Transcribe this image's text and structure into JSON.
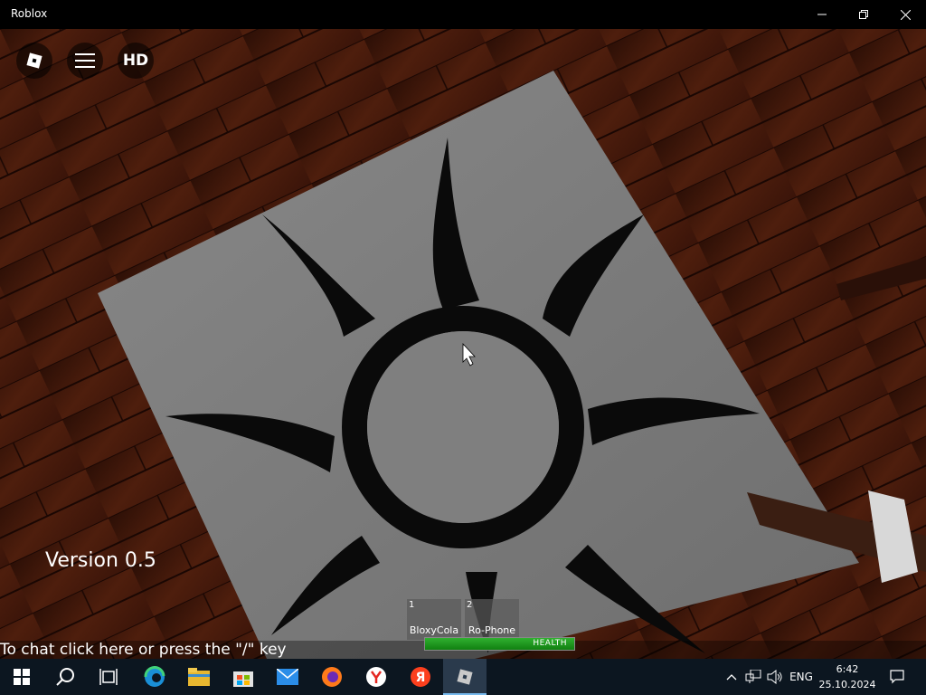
{
  "window": {
    "title": "Roblox"
  },
  "game": {
    "version_text": "Version 0.5",
    "chat_hint": "To chat click here or press the \"/\" key",
    "hotbar": [
      {
        "slot": "1",
        "label": "BloxyCola"
      },
      {
        "slot": "2",
        "label": "Ro-Phone"
      }
    ],
    "health": {
      "label": "HEALTH",
      "fraction": 1.0,
      "color": "#22a022"
    },
    "top_buttons": [
      "roblox-menu-icon",
      "hamburger-menu-icon",
      "hd-record-icon"
    ]
  },
  "taskbar": {
    "apps": [
      "start-icon",
      "search-icon",
      "task-view-icon",
      "edge-icon",
      "file-explorer-icon",
      "store-icon",
      "mail-icon",
      "firefox-icon",
      "yandex-browser-icon",
      "yandex-icon",
      "roblox-icon"
    ],
    "language": "ENG",
    "time": "6:42",
    "date": "25.10.2024"
  },
  "colors": {
    "floor": "#4a1c0c",
    "plate": "#7b7b7b",
    "emblem": "#0a0a0a",
    "taskbar": "#0c1620"
  }
}
